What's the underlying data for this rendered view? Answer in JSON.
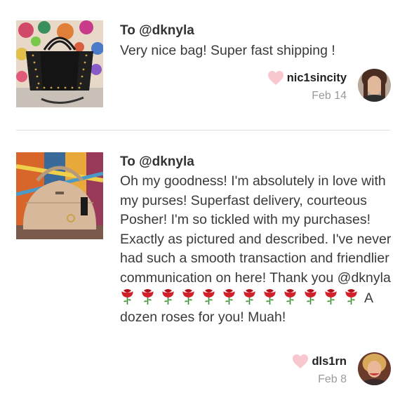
{
  "reviews": [
    {
      "to": "To @dknyla",
      "text": "Very nice bag! Super fast shipping !",
      "username": "nic1sincity",
      "date": "Feb 14",
      "image": "black-studded-handbag-photo",
      "avatar": "user-avatar-photo"
    },
    {
      "to": "To @dknyla",
      "text_before_roses": "Oh my goodness! I'm absolutely in love with my purses! Superfast delivery, courteous Posher! I'm so tickled with my purchases! Exactly as pictured and described. I've never had such a smooth transaction and friendlier communication on here! Thank you @dknyla",
      "rose_count": 12,
      "rose_emoji": "🌹",
      "text_after_roses": "A dozen roses for you! Muah!",
      "username": "dls1rn",
      "date": "Feb 8",
      "image": "beige-dome-satchel-photo",
      "avatar": "user-avatar-photo"
    }
  ],
  "colors": {
    "heart": "#f9c8cf",
    "text": "#3a3a3a",
    "username": "#222222",
    "date": "#9a9a9a",
    "divider": "#dddddd"
  }
}
